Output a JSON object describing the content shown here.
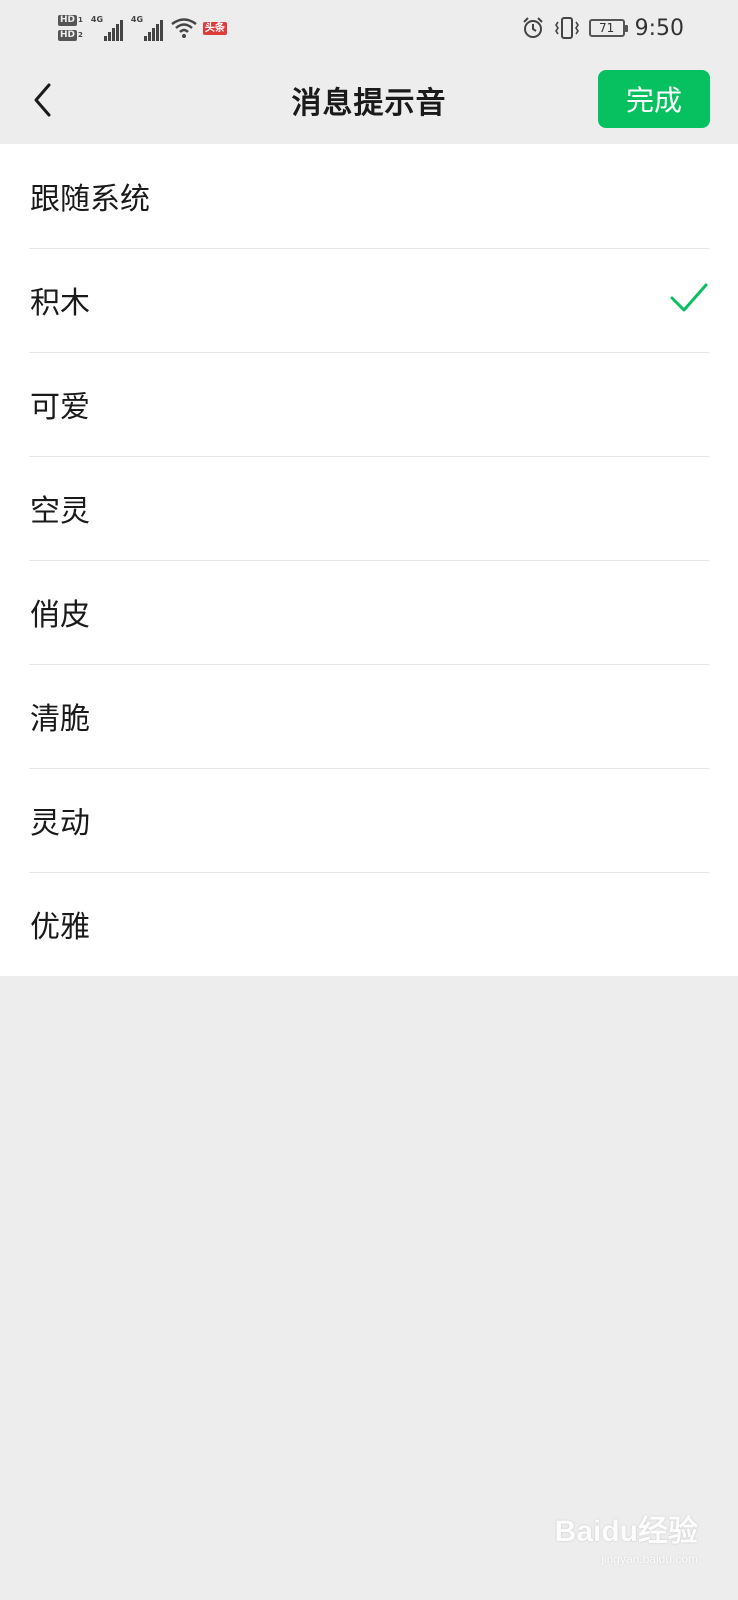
{
  "status_bar": {
    "hd1": "HD",
    "hd1_index": "1",
    "hd2": "HD",
    "hd2_index": "2",
    "net1": "4G",
    "net2": "4G",
    "notification_badge": "头条",
    "battery_level": "71",
    "time": "9:50",
    "icons": [
      "alarm-icon",
      "vibrate-icon",
      "battery-icon",
      "wifi-icon",
      "signal-icon"
    ]
  },
  "header": {
    "title": "消息提示音",
    "done_label": "完成",
    "back_icon": "back-chevron-icon"
  },
  "options": [
    {
      "label": "跟随系统",
      "selected": false
    },
    {
      "label": "积木",
      "selected": true
    },
    {
      "label": "可爱",
      "selected": false
    },
    {
      "label": "空灵",
      "selected": false
    },
    {
      "label": "俏皮",
      "selected": false
    },
    {
      "label": "清脆",
      "selected": false
    },
    {
      "label": "灵动",
      "selected": false
    },
    {
      "label": "优雅",
      "selected": false
    }
  ],
  "colors": {
    "accent": "#07c160",
    "background": "#ededed",
    "list_background": "#ffffff"
  },
  "watermark": {
    "brand": "Baidu经验",
    "sub": "jingyan.baidu.com"
  }
}
